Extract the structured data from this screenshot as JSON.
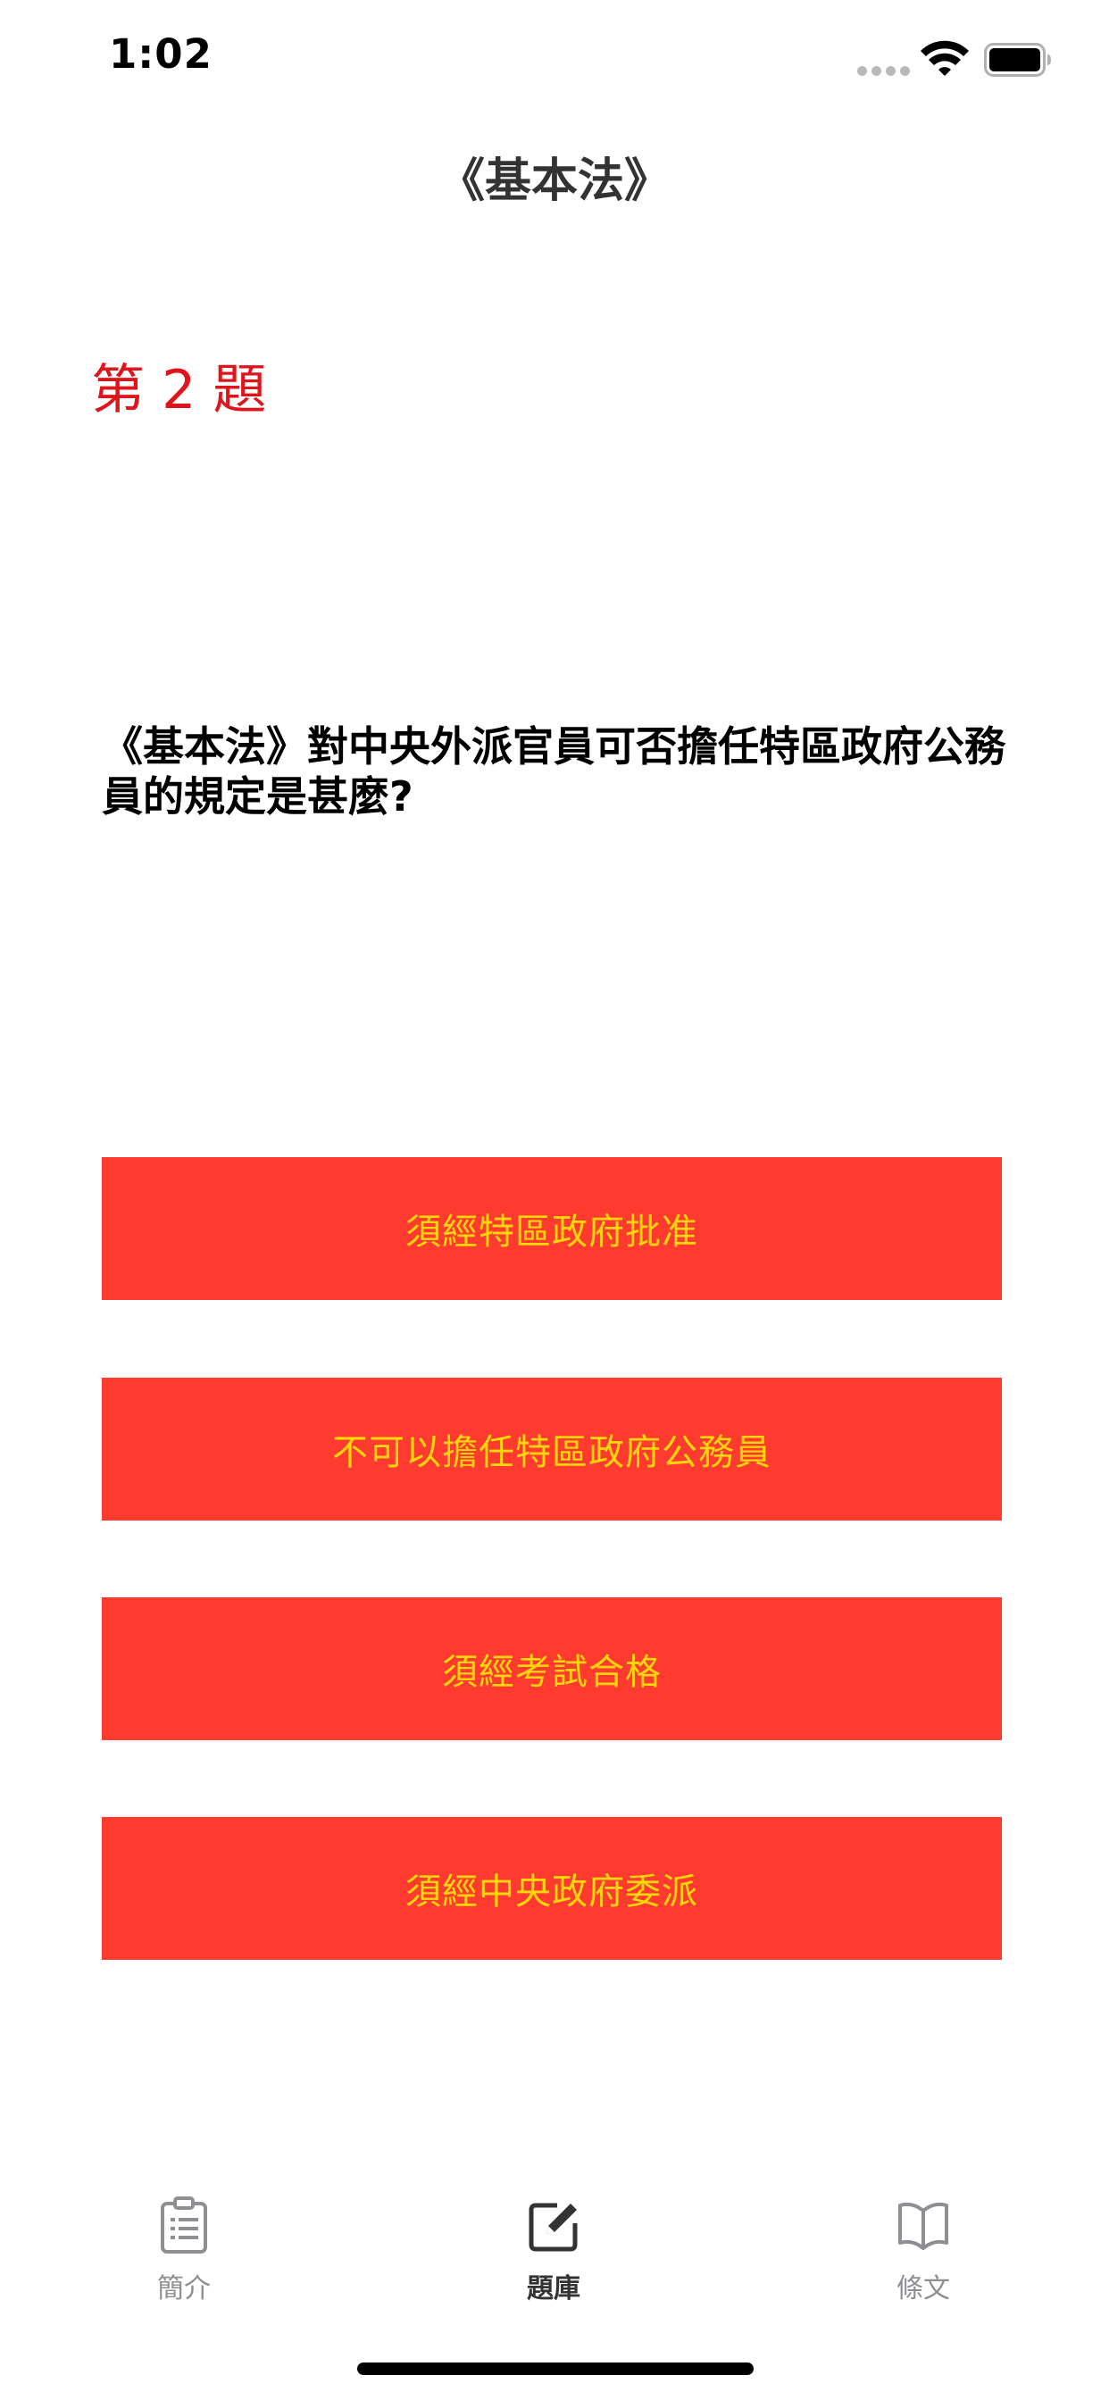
{
  "status_bar": {
    "time": "1:02",
    "icons": [
      "signal-dots-icon",
      "wifi-icon",
      "battery-icon"
    ]
  },
  "nav": {
    "title": "《基本法》"
  },
  "question": {
    "number_label": "第 2 題",
    "text": "《基本法》對中央外派官員可否擔任特區政府公務員的規定是甚麼?"
  },
  "options": [
    {
      "label": "須經特區政府批准"
    },
    {
      "label": "不可以擔任特區政府公務員"
    },
    {
      "label": "須經考試合格"
    },
    {
      "label": "須經中央政府委派"
    }
  ],
  "tab_bar": {
    "tabs": [
      {
        "label": "簡介",
        "icon": "clipboard-icon",
        "active": false
      },
      {
        "label": "題庫",
        "icon": "edit-icon",
        "active": true
      },
      {
        "label": "條文",
        "icon": "book-icon",
        "active": false
      }
    ]
  },
  "colors": {
    "option_background": "#ff3b30",
    "option_text": "#ffd60a",
    "question_number": "#e0141b",
    "tab_inactive": "#8e8e93",
    "tab_active": "#333333"
  }
}
